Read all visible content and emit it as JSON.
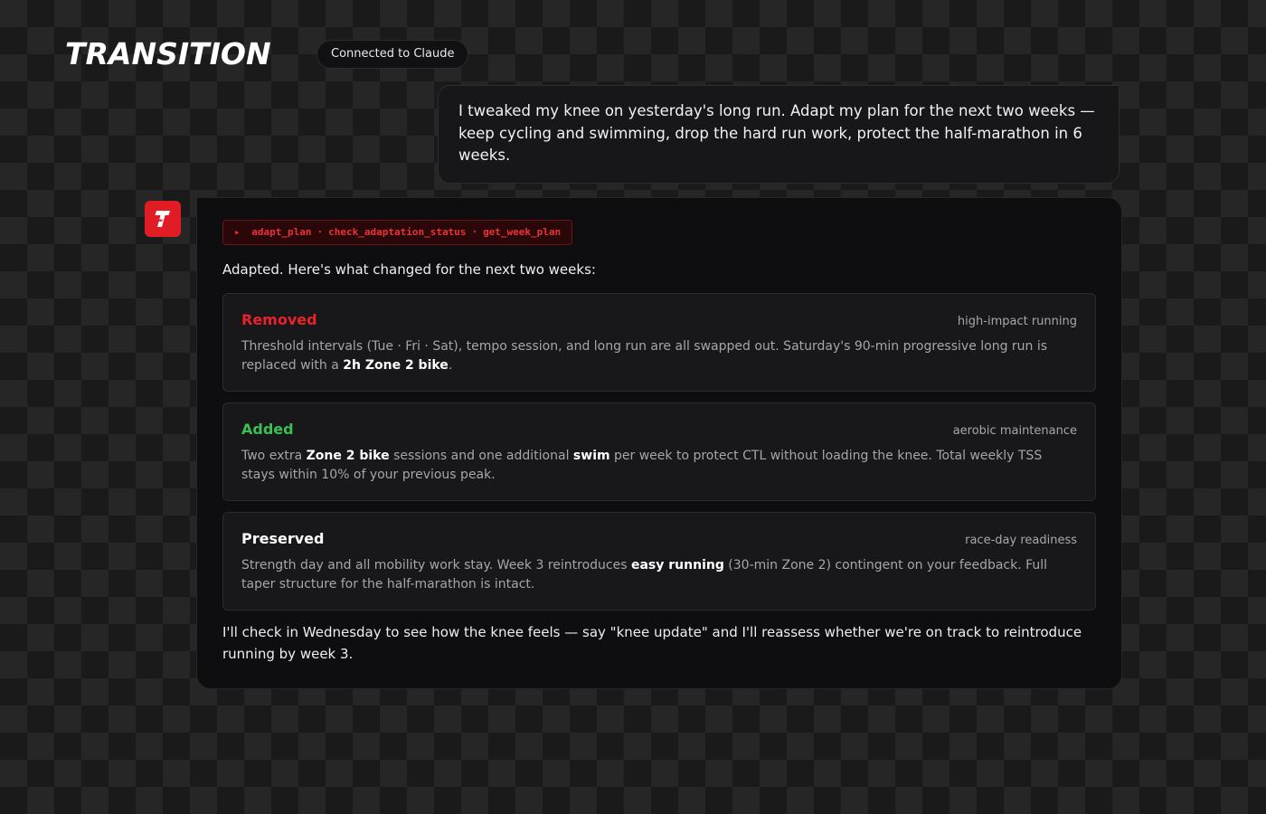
{
  "app": {
    "logo_text": "TRANSITION",
    "status_badge": "Connected to Claude"
  },
  "user_message": {
    "text": "I tweaked my knee on yesterday's long run. Adapt my plan for the next two weeks — keep cycling and swimming, drop the hard run work, protect the half-marathon in 6 weeks."
  },
  "assistant": {
    "avatar_icon": "transition-logo-icon",
    "avatar_letter": "T",
    "tool_calls": [
      "adapt_plan",
      "check_adaptation_status",
      "get_week_plan"
    ],
    "tool_marker": "▸",
    "tool_separator": "·",
    "intro": "Adapted. Here's what changed for the next two weeks:",
    "sections": [
      {
        "title": "Removed",
        "tag": "high-impact running",
        "color": "#e8232b",
        "body_parts": [
          {
            "text": "Threshold intervals (Tue · Fri · Sat), tempo session, and long run are all swapped out. Saturday's 90-min progressive long run is replaced with a ",
            "bold": false
          },
          {
            "text": "2h Zone 2 bike",
            "bold": true
          },
          {
            "text": ".",
            "bold": false
          }
        ]
      },
      {
        "title": "Added",
        "tag": "aerobic maintenance",
        "color": "#3bbf52",
        "body_parts": [
          {
            "text": "Two extra ",
            "bold": false
          },
          {
            "text": "Zone 2 bike",
            "bold": true
          },
          {
            "text": " sessions and one additional ",
            "bold": false
          },
          {
            "text": "swim",
            "bold": true
          },
          {
            "text": " per week to protect CTL without loading the knee. Total weekly TSS stays within 10% of your previous peak.",
            "bold": false
          }
        ]
      },
      {
        "title": "Preserved",
        "tag": "race-day readiness",
        "color": "#ffffff",
        "body_parts": [
          {
            "text": "Strength day and all mobility work stay. Week 3 reintroduces ",
            "bold": false
          },
          {
            "text": "easy running",
            "bold": true
          },
          {
            "text": " (30-min Zone 2) contingent on your feedback. Full taper structure for the half-marathon is intact.",
            "bold": false
          }
        ]
      }
    ],
    "outro": "I'll check in Wednesday to see how the knee feels — say \"knee update\" and I'll reassess whether we're on track to reintroduce running by week 3."
  },
  "colors": {
    "accent_red": "#e01c24",
    "added_green": "#3bbf52"
  }
}
